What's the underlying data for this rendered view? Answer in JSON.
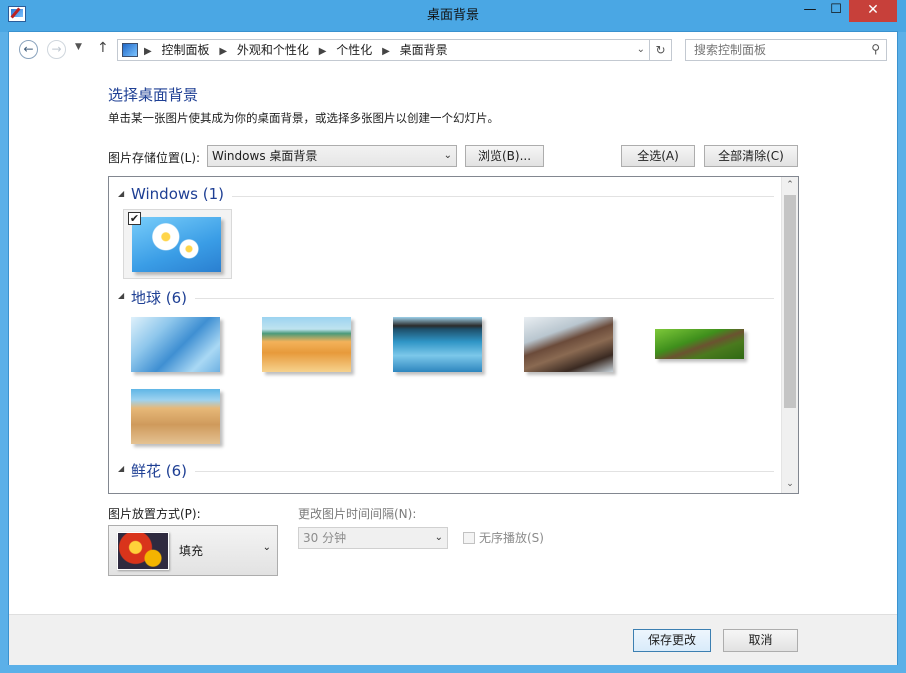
{
  "window": {
    "title": "桌面背景",
    "min_glyph": "—",
    "max_glyph": "☐",
    "close_glyph": "✕"
  },
  "nav": {
    "back_glyph": "←",
    "forward_glyph": "→",
    "recent_glyph": "▼",
    "up_glyph": "↑",
    "breadcrumbs": [
      "控制面板",
      "外观和个性化",
      "个性化",
      "桌面背景"
    ],
    "separator": "▶",
    "addr_dropdown_glyph": "⌄",
    "refresh_glyph": "↻",
    "search_placeholder": "搜索控制面板",
    "search_glyph": "⚲"
  },
  "content": {
    "heading": "选择桌面背景",
    "description": "单击某一张图片使其成为你的桌面背景，或选择多张图片以创建一个幻灯片。",
    "location_label": "图片存储位置(L):",
    "location_value": "Windows 桌面背景",
    "browse_label": "浏览(B)...",
    "select_all_label": "全选(A)",
    "clear_all_label": "全部清除(C)"
  },
  "gallery": {
    "collapse_glyph": "◢",
    "groups": [
      {
        "name": "Windows (1)"
      },
      {
        "name": "地球 (6)"
      },
      {
        "name": "鲜花 (6)"
      }
    ],
    "check_glyph": "✔",
    "scroll_up_glyph": "⌃",
    "scroll_down_glyph": "⌄"
  },
  "options": {
    "position_label": "图片放置方式(P):",
    "position_value": "填充",
    "interval_label": "更改图片时间间隔(N):",
    "interval_value": "30 分钟",
    "shuffle_label": "无序播放(S)",
    "dropdown_glyph": "⌄"
  },
  "footer": {
    "save_label": "保存更改",
    "cancel_label": "取消"
  }
}
